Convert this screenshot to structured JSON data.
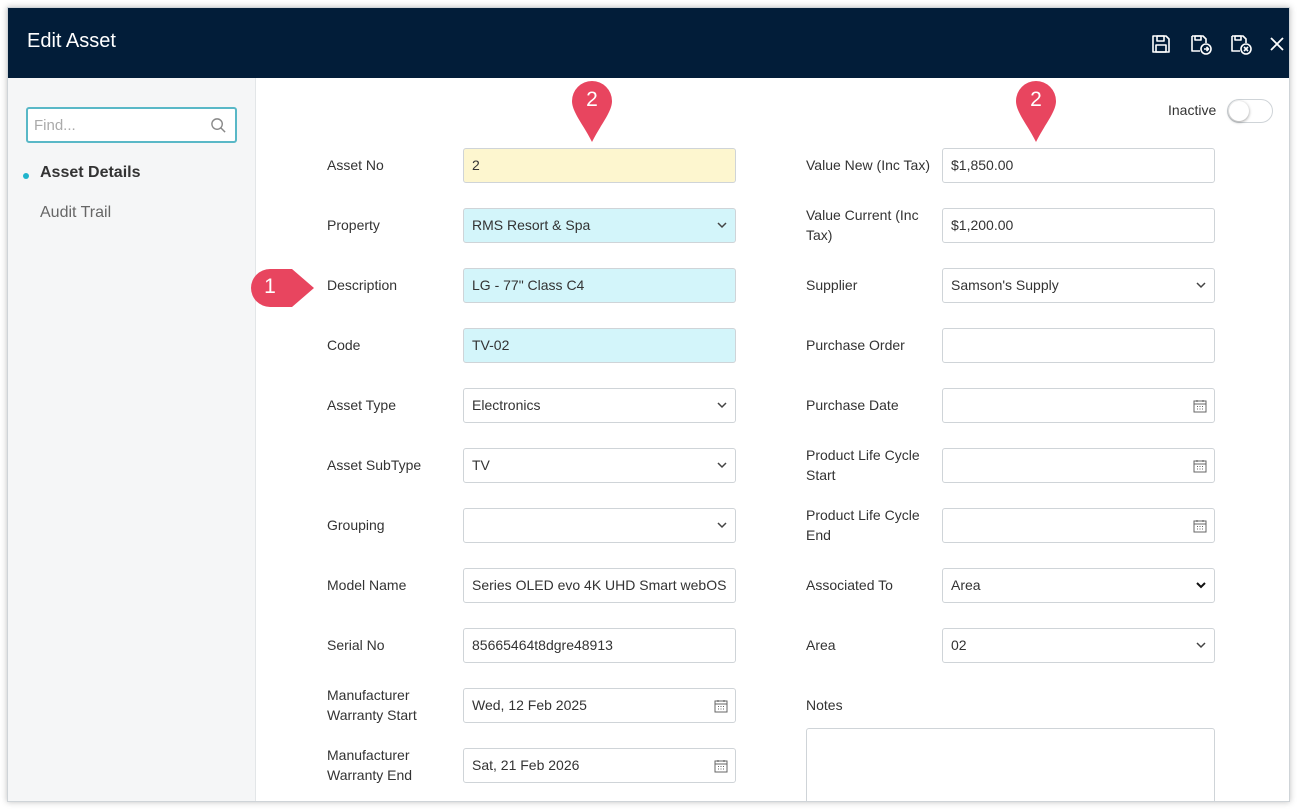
{
  "dialog": {
    "title": "Edit Asset"
  },
  "toolbar": [
    "save-icon",
    "save-new-icon",
    "save-close-icon",
    "close-icon"
  ],
  "sidebar": {
    "search_placeholder": "Find...",
    "items": [
      {
        "label": "Asset Details",
        "active": true
      },
      {
        "label": "Audit Trail",
        "active": false
      }
    ]
  },
  "inactive": {
    "label": "Inactive",
    "on": false
  },
  "left_fields": [
    {
      "label": "Asset No",
      "value": "2"
    },
    {
      "label": "Property",
      "value": "RMS Resort & Spa"
    },
    {
      "label": "Description",
      "value": "LG - 77\" Class C4"
    },
    {
      "label": "Code",
      "value": "TV-02"
    },
    {
      "label": "Asset Type",
      "value": "Electronics"
    },
    {
      "label": "Asset SubType",
      "value": "TV"
    },
    {
      "label": "Grouping",
      "value": ""
    },
    {
      "label": "Model Name",
      "value": "Series OLED evo 4K UHD Smart webOS"
    },
    {
      "label": "Serial No",
      "value": "85665464t8dgre48913"
    },
    {
      "label": "Manufacturer Warranty Start",
      "value": "Wed, 12 Feb 2025"
    },
    {
      "label": "Manufacturer Warranty End",
      "value": "Sat, 21 Feb 2026"
    }
  ],
  "right_fields": [
    {
      "label": "Value New (Inc Tax)",
      "value": "$1,850.00"
    },
    {
      "label": "Value Current (Inc Tax)",
      "value": "$1,200.00"
    },
    {
      "label": "Supplier",
      "value": "Samson's Supply"
    },
    {
      "label": "Purchase Order",
      "value": ""
    },
    {
      "label": "Purchase Date",
      "value": ""
    },
    {
      "label": "Product Life Cycle Start",
      "value": ""
    },
    {
      "label": "Product Life Cycle End",
      "value": ""
    },
    {
      "label": "Associated To",
      "value": "Area"
    },
    {
      "label": "Area",
      "value": "02"
    },
    {
      "label": "Notes",
      "value": ""
    }
  ],
  "markers": [
    "1",
    "2",
    "2"
  ],
  "colors": {
    "header": "#021d39",
    "marker": "#e8455f",
    "required": "#d3f5fa",
    "key": "#fdf6cf",
    "accent": "#1fb4cc"
  }
}
